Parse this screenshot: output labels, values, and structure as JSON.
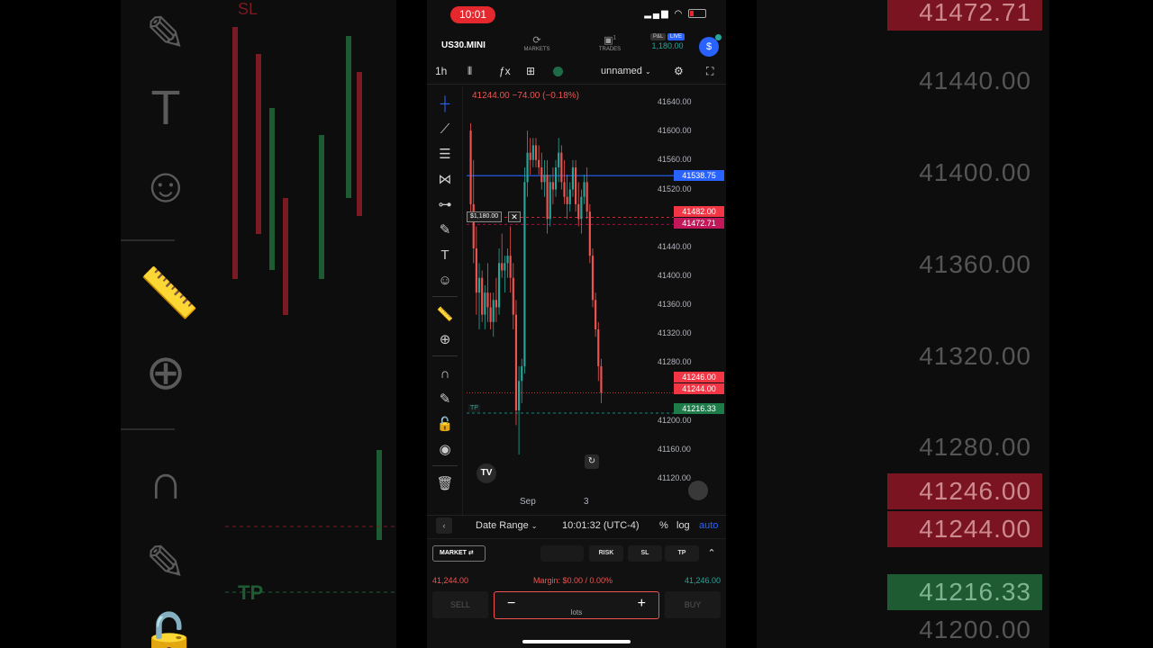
{
  "status": {
    "time": "10:01"
  },
  "header": {
    "symbol": "US30.MINI",
    "markets_label": "MARKETS",
    "trades_label": "TRADES",
    "trades_count": "1",
    "pnl_tag": "P&L",
    "live_tag": "LIVE",
    "pnl_amount": "1,180.00",
    "avatar_glyph": "$"
  },
  "toolbar": {
    "interval": "1h",
    "indicator_glyph": "ƒx",
    "layout_name": "unnamed"
  },
  "chart": {
    "ohlc_text": "41244.00  −74.00 (−0.18%)",
    "position_pnl": "$1,180.00",
    "tp_tag": "TP",
    "tv_logo": "TV",
    "x_labels": [
      "Sep",
      "3"
    ],
    "y_labels": [
      "41640.00",
      "41600.00",
      "41560.00",
      "41520.00",
      "41440.00",
      "41400.00",
      "41360.00",
      "41320.00",
      "41280.00",
      "41200.00",
      "41160.00",
      "41120.00"
    ],
    "badges": {
      "blue": "41538.75",
      "sl": "41482.00",
      "sl2": "41472.71",
      "ask": "41246.00",
      "bid": "41244.00",
      "tp": "41216.33"
    },
    "colors": {
      "up": "#26a69a",
      "down": "#ef5350",
      "blue_line": "#2962ff"
    }
  },
  "chart_data": {
    "type": "candlestick",
    "interval": "1h",
    "ylim": [
      41110,
      41660
    ],
    "x_ticks": [
      "Sep",
      "3"
    ],
    "last_price": 41244.0,
    "change": -74.0,
    "change_pct": -0.18,
    "levels": {
      "blue_line": 41538.75,
      "stop_loss": 41482.0,
      "sl_secondary": 41472.71,
      "ask": 41246.0,
      "bid": 41244.0,
      "take_profit": 41216.33
    },
    "candles": [
      [
        41600,
        41610,
        41480,
        41500
      ],
      [
        41500,
        41560,
        41420,
        41440
      ],
      [
        41440,
        41470,
        41350,
        41380
      ],
      [
        41380,
        41420,
        41330,
        41400
      ],
      [
        41400,
        41410,
        41340,
        41350
      ],
      [
        41350,
        41390,
        41330,
        41380
      ],
      [
        41380,
        41420,
        41340,
        41360
      ],
      [
        41360,
        41380,
        41330,
        41340
      ],
      [
        41340,
        41380,
        41320,
        41370
      ],
      [
        41370,
        41400,
        41340,
        41360
      ],
      [
        41360,
        41440,
        41350,
        41420
      ],
      [
        41420,
        41460,
        41400,
        41410
      ],
      [
        41410,
        41430,
        41380,
        41420
      ],
      [
        41420,
        41440,
        41400,
        41430
      ],
      [
        41430,
        41470,
        41380,
        41400
      ],
      [
        41400,
        41420,
        41330,
        41350
      ],
      [
        41350,
        41370,
        41200,
        41220
      ],
      [
        41220,
        41280,
        41160,
        41260
      ],
      [
        41260,
        41290,
        41230,
        41280
      ],
      [
        41280,
        41550,
        41270,
        41530
      ],
      [
        41530,
        41600,
        41510,
        41570
      ],
      [
        41570,
        41590,
        41540,
        41560
      ],
      [
        41560,
        41590,
        41550,
        41580
      ],
      [
        41580,
        41590,
        41550,
        41560
      ],
      [
        41560,
        41580,
        41540,
        41550
      ],
      [
        41550,
        41570,
        41520,
        41530
      ],
      [
        41530,
        41560,
        41510,
        41540
      ],
      [
        41540,
        41560,
        41460,
        41480
      ],
      [
        41480,
        41540,
        41470,
        41530
      ],
      [
        41530,
        41550,
        41500,
        41520
      ],
      [
        41520,
        41560,
        41510,
        41550
      ],
      [
        41550,
        41590,
        41530,
        41570
      ],
      [
        41570,
        41580,
        41520,
        41530
      ],
      [
        41530,
        41560,
        41500,
        41510
      ],
      [
        41510,
        41540,
        41480,
        41500
      ],
      [
        41500,
        41530,
        41490,
        41520
      ],
      [
        41520,
        41560,
        41510,
        41550
      ],
      [
        41550,
        41560,
        41490,
        41500
      ],
      [
        41500,
        41530,
        41470,
        41480
      ],
      [
        41480,
        41520,
        41460,
        41510
      ],
      [
        41510,
        41540,
        41500,
        41530
      ],
      [
        41530,
        41550,
        41480,
        41490
      ],
      [
        41490,
        41500,
        41420,
        41430
      ],
      [
        41430,
        41440,
        41360,
        41370
      ],
      [
        41370,
        41380,
        41320,
        41330
      ],
      [
        41330,
        41340,
        41260,
        41280
      ],
      [
        41280,
        41290,
        41230,
        41244
      ]
    ]
  },
  "bottombar": {
    "date_range": "Date Range",
    "clock": "10:01:32 (UTC-4)",
    "percent": "%",
    "log": "log",
    "auto": "auto"
  },
  "order": {
    "type_label": "MARKET",
    "risk_label": "RISK",
    "sl_label": "SL",
    "tp_label": "TP",
    "bid": "41,244.00",
    "margin": "Margin: $0.00 / 0.00%",
    "ask": "41,246.00",
    "sell_label": "SELL",
    "buy_label": "BUY",
    "lots_label": "lots"
  },
  "background": {
    "prices": [
      "41472.71",
      "41440.00",
      "41400.00",
      "41360.00",
      "41320.00",
      "41280.00",
      "41246.00",
      "41244.00",
      "41216.33",
      "41200.00"
    ],
    "sl_tag": "SL",
    "tp_tag": "TP"
  }
}
